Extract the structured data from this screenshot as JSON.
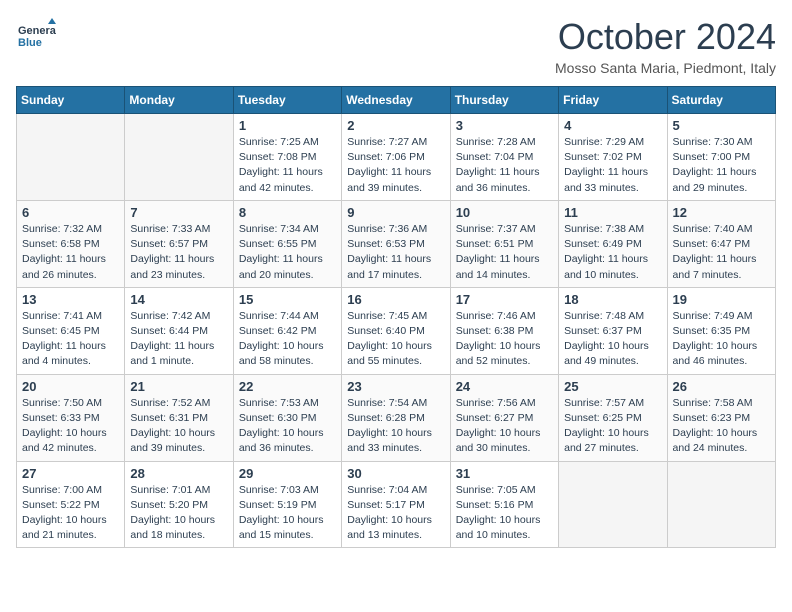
{
  "header": {
    "logo": {
      "line1": "General",
      "line2": "Blue"
    },
    "title": "October 2024",
    "location": "Mosso Santa Maria, Piedmont, Italy"
  },
  "days_of_week": [
    "Sunday",
    "Monday",
    "Tuesday",
    "Wednesday",
    "Thursday",
    "Friday",
    "Saturday"
  ],
  "weeks": [
    [
      {
        "day": "",
        "empty": true
      },
      {
        "day": "",
        "empty": true
      },
      {
        "day": "1",
        "sunrise": "7:25 AM",
        "sunset": "7:08 PM",
        "daylight": "11 hours and 42 minutes."
      },
      {
        "day": "2",
        "sunrise": "7:27 AM",
        "sunset": "7:06 PM",
        "daylight": "11 hours and 39 minutes."
      },
      {
        "day": "3",
        "sunrise": "7:28 AM",
        "sunset": "7:04 PM",
        "daylight": "11 hours and 36 minutes."
      },
      {
        "day": "4",
        "sunrise": "7:29 AM",
        "sunset": "7:02 PM",
        "daylight": "11 hours and 33 minutes."
      },
      {
        "day": "5",
        "sunrise": "7:30 AM",
        "sunset": "7:00 PM",
        "daylight": "11 hours and 29 minutes."
      }
    ],
    [
      {
        "day": "6",
        "sunrise": "7:32 AM",
        "sunset": "6:58 PM",
        "daylight": "11 hours and 26 minutes."
      },
      {
        "day": "7",
        "sunrise": "7:33 AM",
        "sunset": "6:57 PM",
        "daylight": "11 hours and 23 minutes."
      },
      {
        "day": "8",
        "sunrise": "7:34 AM",
        "sunset": "6:55 PM",
        "daylight": "11 hours and 20 minutes."
      },
      {
        "day": "9",
        "sunrise": "7:36 AM",
        "sunset": "6:53 PM",
        "daylight": "11 hours and 17 minutes."
      },
      {
        "day": "10",
        "sunrise": "7:37 AM",
        "sunset": "6:51 PM",
        "daylight": "11 hours and 14 minutes."
      },
      {
        "day": "11",
        "sunrise": "7:38 AM",
        "sunset": "6:49 PM",
        "daylight": "11 hours and 10 minutes."
      },
      {
        "day": "12",
        "sunrise": "7:40 AM",
        "sunset": "6:47 PM",
        "daylight": "11 hours and 7 minutes."
      }
    ],
    [
      {
        "day": "13",
        "sunrise": "7:41 AM",
        "sunset": "6:45 PM",
        "daylight": "11 hours and 4 minutes."
      },
      {
        "day": "14",
        "sunrise": "7:42 AM",
        "sunset": "6:44 PM",
        "daylight": "11 hours and 1 minute."
      },
      {
        "day": "15",
        "sunrise": "7:44 AM",
        "sunset": "6:42 PM",
        "daylight": "10 hours and 58 minutes."
      },
      {
        "day": "16",
        "sunrise": "7:45 AM",
        "sunset": "6:40 PM",
        "daylight": "10 hours and 55 minutes."
      },
      {
        "day": "17",
        "sunrise": "7:46 AM",
        "sunset": "6:38 PM",
        "daylight": "10 hours and 52 minutes."
      },
      {
        "day": "18",
        "sunrise": "7:48 AM",
        "sunset": "6:37 PM",
        "daylight": "10 hours and 49 minutes."
      },
      {
        "day": "19",
        "sunrise": "7:49 AM",
        "sunset": "6:35 PM",
        "daylight": "10 hours and 46 minutes."
      }
    ],
    [
      {
        "day": "20",
        "sunrise": "7:50 AM",
        "sunset": "6:33 PM",
        "daylight": "10 hours and 42 minutes."
      },
      {
        "day": "21",
        "sunrise": "7:52 AM",
        "sunset": "6:31 PM",
        "daylight": "10 hours and 39 minutes."
      },
      {
        "day": "22",
        "sunrise": "7:53 AM",
        "sunset": "6:30 PM",
        "daylight": "10 hours and 36 minutes."
      },
      {
        "day": "23",
        "sunrise": "7:54 AM",
        "sunset": "6:28 PM",
        "daylight": "10 hours and 33 minutes."
      },
      {
        "day": "24",
        "sunrise": "7:56 AM",
        "sunset": "6:27 PM",
        "daylight": "10 hours and 30 minutes."
      },
      {
        "day": "25",
        "sunrise": "7:57 AM",
        "sunset": "6:25 PM",
        "daylight": "10 hours and 27 minutes."
      },
      {
        "day": "26",
        "sunrise": "7:58 AM",
        "sunset": "6:23 PM",
        "daylight": "10 hours and 24 minutes."
      }
    ],
    [
      {
        "day": "27",
        "sunrise": "7:00 AM",
        "sunset": "5:22 PM",
        "daylight": "10 hours and 21 minutes."
      },
      {
        "day": "28",
        "sunrise": "7:01 AM",
        "sunset": "5:20 PM",
        "daylight": "10 hours and 18 minutes."
      },
      {
        "day": "29",
        "sunrise": "7:03 AM",
        "sunset": "5:19 PM",
        "daylight": "10 hours and 15 minutes."
      },
      {
        "day": "30",
        "sunrise": "7:04 AM",
        "sunset": "5:17 PM",
        "daylight": "10 hours and 13 minutes."
      },
      {
        "day": "31",
        "sunrise": "7:05 AM",
        "sunset": "5:16 PM",
        "daylight": "10 hours and 10 minutes."
      },
      {
        "day": "",
        "empty": true
      },
      {
        "day": "",
        "empty": true
      }
    ]
  ]
}
